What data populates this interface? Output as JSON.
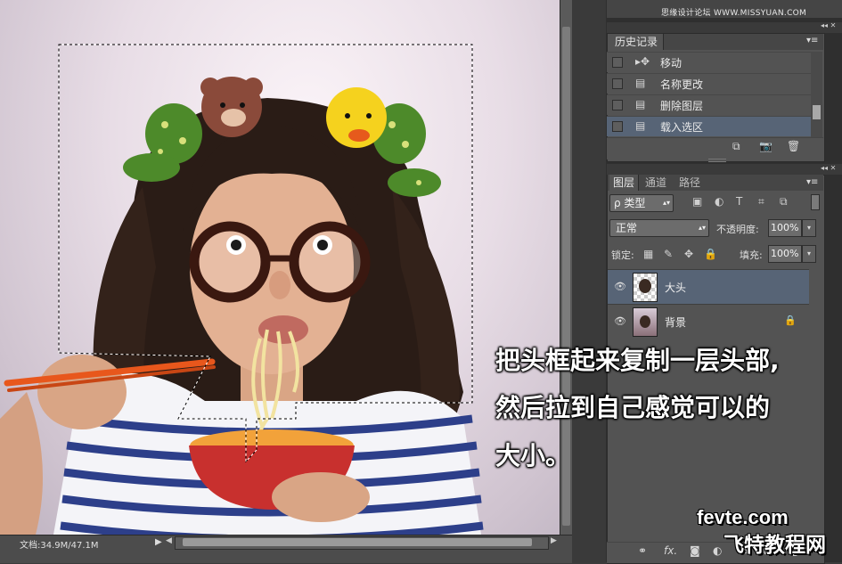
{
  "watermark_top": "思缘设计论坛 WWW.MISSYUAN.COM",
  "status": {
    "doc_info": "文档:34.9M/47.1M",
    "arrow": "▶",
    "hs_left": "◀",
    "hs_right": "▶"
  },
  "history": {
    "tab": "历史记录",
    "menu": "▾≡",
    "collapse": "◂◂ ✕",
    "items": [
      {
        "icon": "move-tool-icon",
        "glyph": "▸✥",
        "label": "移动",
        "selected": false
      },
      {
        "icon": "document-icon",
        "glyph": "▤",
        "label": "名称更改",
        "selected": false
      },
      {
        "icon": "document-icon",
        "glyph": "▤",
        "label": "删除图层",
        "selected": false
      },
      {
        "icon": "document-icon",
        "glyph": "▤",
        "label": "载入选区",
        "selected": true
      }
    ],
    "footer_icons": [
      "⧉",
      "📷",
      "🗑"
    ]
  },
  "layers": {
    "tabs": [
      "图层",
      "通道",
      "路径"
    ],
    "menu": "▾≡",
    "collapse": "◂◂ ✕",
    "filter_kind": "ρ 类型",
    "filter_icons": [
      "▣",
      "◐",
      "T",
      "⌗",
      "⧉"
    ],
    "blend_mode": "正常",
    "opacity_label": "不透明度:",
    "opacity_value": "100%",
    "lock_label": "锁定:",
    "lock_icons": [
      "▦",
      "✎",
      "✥",
      "🔒"
    ],
    "fill_label": "填充:",
    "fill_value": "100%",
    "items": [
      {
        "name": "大头",
        "visible": "👁",
        "selected": true,
        "locked": ""
      },
      {
        "name": "背景",
        "visible": "👁",
        "selected": false,
        "locked": "🔒"
      }
    ],
    "footer_icons": [
      "⚭",
      "fx.",
      "◙",
      "◐",
      "▭",
      "⧉",
      "🗑"
    ]
  },
  "caption": {
    "line1": "把头框起来复制一层头部,",
    "line2": "然后拉到自己感觉可以的",
    "line3": "大小。"
  },
  "watermark_bottom": {
    "brand": "fevte.com",
    "brand_cn": "飞特教程网"
  },
  "colors": {
    "panel": "#535353",
    "selected_row": "#576476",
    "canvas_bg": "#e8dde6",
    "bowl": "#c8302e",
    "chopstick": "#e8571c"
  }
}
